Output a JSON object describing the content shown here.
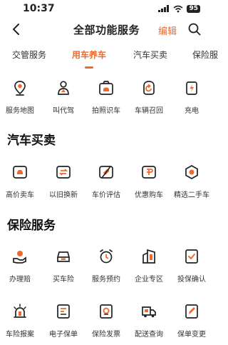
{
  "status_bar": {
    "time": "10:37",
    "battery": "95"
  },
  "header": {
    "title": "全部功能服务",
    "edit_label": "编辑"
  },
  "tabs": [
    {
      "label": "交管服务"
    },
    {
      "label": "用车养车"
    },
    {
      "label": "汽车买卖"
    },
    {
      "label": "保险服"
    }
  ],
  "car_service_items": [
    {
      "label": "服务地图",
      "icon": "map-pin-icon"
    },
    {
      "label": "叫代驾",
      "icon": "driver-icon"
    },
    {
      "label": "拍照识车",
      "icon": "camera-icon"
    },
    {
      "label": "车辆召回",
      "icon": "recall-icon"
    },
    {
      "label": "充电",
      "icon": "charging-icon"
    }
  ],
  "car_trade": {
    "title": "汽车买卖",
    "items": [
      {
        "label": "高价卖车",
        "icon": "sell-car-icon"
      },
      {
        "label": "以旧换新",
        "icon": "trade-in-icon"
      },
      {
        "label": "车价评估",
        "icon": "price-tag-icon"
      },
      {
        "label": "优惠购车",
        "icon": "coupon-icon"
      },
      {
        "label": "精选二手车",
        "icon": "used-car-icon"
      }
    ]
  },
  "insurance": {
    "title": "保险服务",
    "items": [
      {
        "label": "办理赔",
        "icon": "claim-hand-icon"
      },
      {
        "label": "买车险",
        "icon": "buy-insurance-icon"
      },
      {
        "label": "服务预约",
        "icon": "alarm-clock-icon"
      },
      {
        "label": "企业专区",
        "icon": "building-icon"
      },
      {
        "label": "投保确认",
        "icon": "confirm-doc-icon"
      },
      {
        "label": "车险报案",
        "icon": "alarm-light-icon"
      },
      {
        "label": "电子保单",
        "icon": "e-policy-icon"
      },
      {
        "label": "保险发票",
        "icon": "invoice-icon"
      },
      {
        "label": "配送查询",
        "icon": "delivery-truck-icon"
      },
      {
        "label": "保单变更",
        "icon": "edit-doc-icon"
      }
    ]
  },
  "colors": {
    "accent": "#ee6a2c",
    "icon_stroke": "#222222"
  }
}
